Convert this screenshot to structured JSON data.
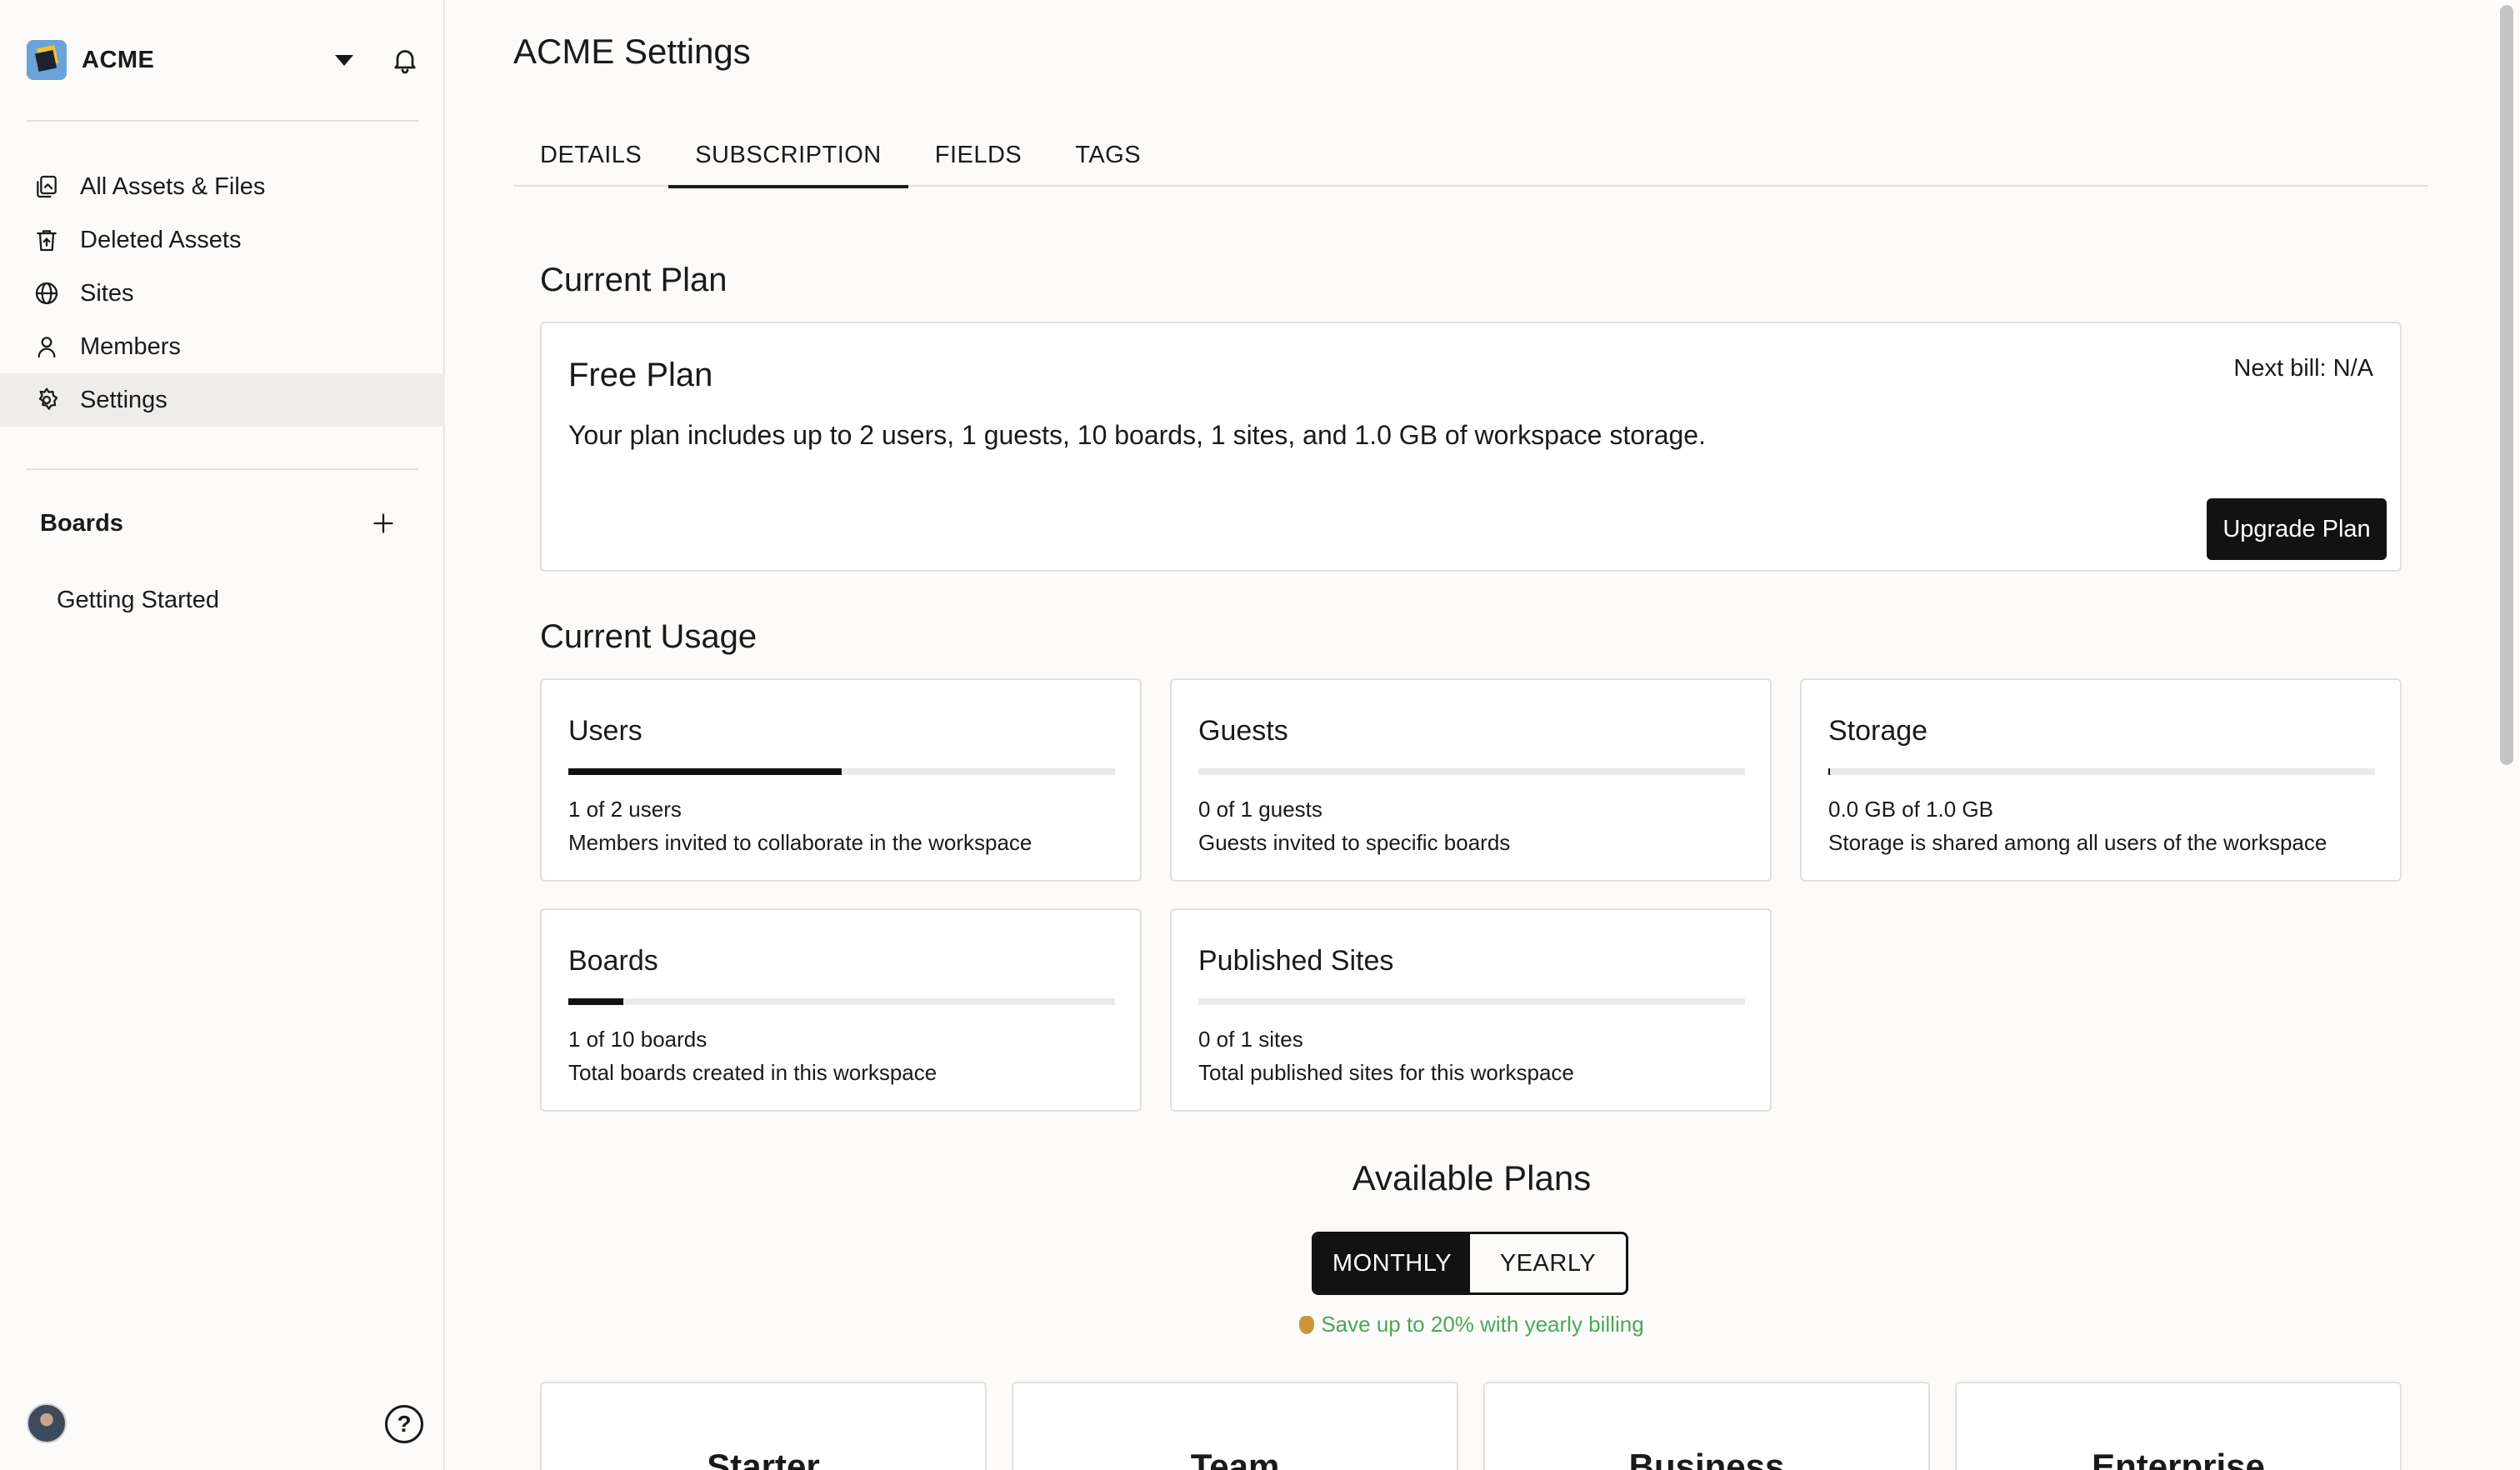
{
  "workspace": {
    "name": "ACME"
  },
  "nav": {
    "items": [
      {
        "label": "All Assets & Files",
        "icon": "files-icon"
      },
      {
        "label": "Deleted Assets",
        "icon": "trash-restore-icon"
      },
      {
        "label": "Sites",
        "icon": "globe-icon"
      },
      {
        "label": "Members",
        "icon": "person-icon"
      },
      {
        "label": "Settings",
        "icon": "gear-icon",
        "active": true
      }
    ]
  },
  "boards": {
    "title": "Boards",
    "items": [
      {
        "label": "Getting Started"
      }
    ]
  },
  "page": {
    "title": "ACME Settings"
  },
  "tabs": [
    {
      "label": "DETAILS"
    },
    {
      "label": "SUBSCRIPTION",
      "active": true
    },
    {
      "label": "FIELDS"
    },
    {
      "label": "TAGS"
    }
  ],
  "current_plan": {
    "section_title": "Current Plan",
    "name": "Free Plan",
    "description": "Your plan includes up to 2 users, 1 guests, 10 boards, 1 sites, and 1.0 GB of workspace storage.",
    "next_bill": "Next bill: N/A",
    "upgrade_label": "Upgrade Plan"
  },
  "usage": {
    "section_title": "Current Usage",
    "cards": [
      {
        "title": "Users",
        "count": "1 of 2 users",
        "desc": "Members invited to collaborate in the workspace",
        "fraction": 0.5
      },
      {
        "title": "Guests",
        "count": "0 of 1 guests",
        "desc": "Guests invited to specific boards",
        "fraction": 0
      },
      {
        "title": "Storage",
        "count": "0.0 GB of 1.0 GB",
        "desc": "Storage is shared among all users of the workspace",
        "fraction": 0.003
      },
      {
        "title": "Boards",
        "count": "1 of 10 boards",
        "desc": "Total boards created in this workspace",
        "fraction": 0.1
      },
      {
        "title": "Published Sites",
        "count": "0 of 1 sites",
        "desc": "Total published sites for this workspace",
        "fraction": 0
      }
    ]
  },
  "plans": {
    "title": "Available Plans",
    "billing": {
      "monthly": "MONTHLY",
      "yearly": "YEARLY",
      "selected": "monthly"
    },
    "save_note": "Save up to 20% with yearly billing",
    "tiers": [
      {
        "name": "Starter"
      },
      {
        "name": "Team"
      },
      {
        "name": "Business"
      },
      {
        "name": "Enterprise"
      }
    ]
  }
}
